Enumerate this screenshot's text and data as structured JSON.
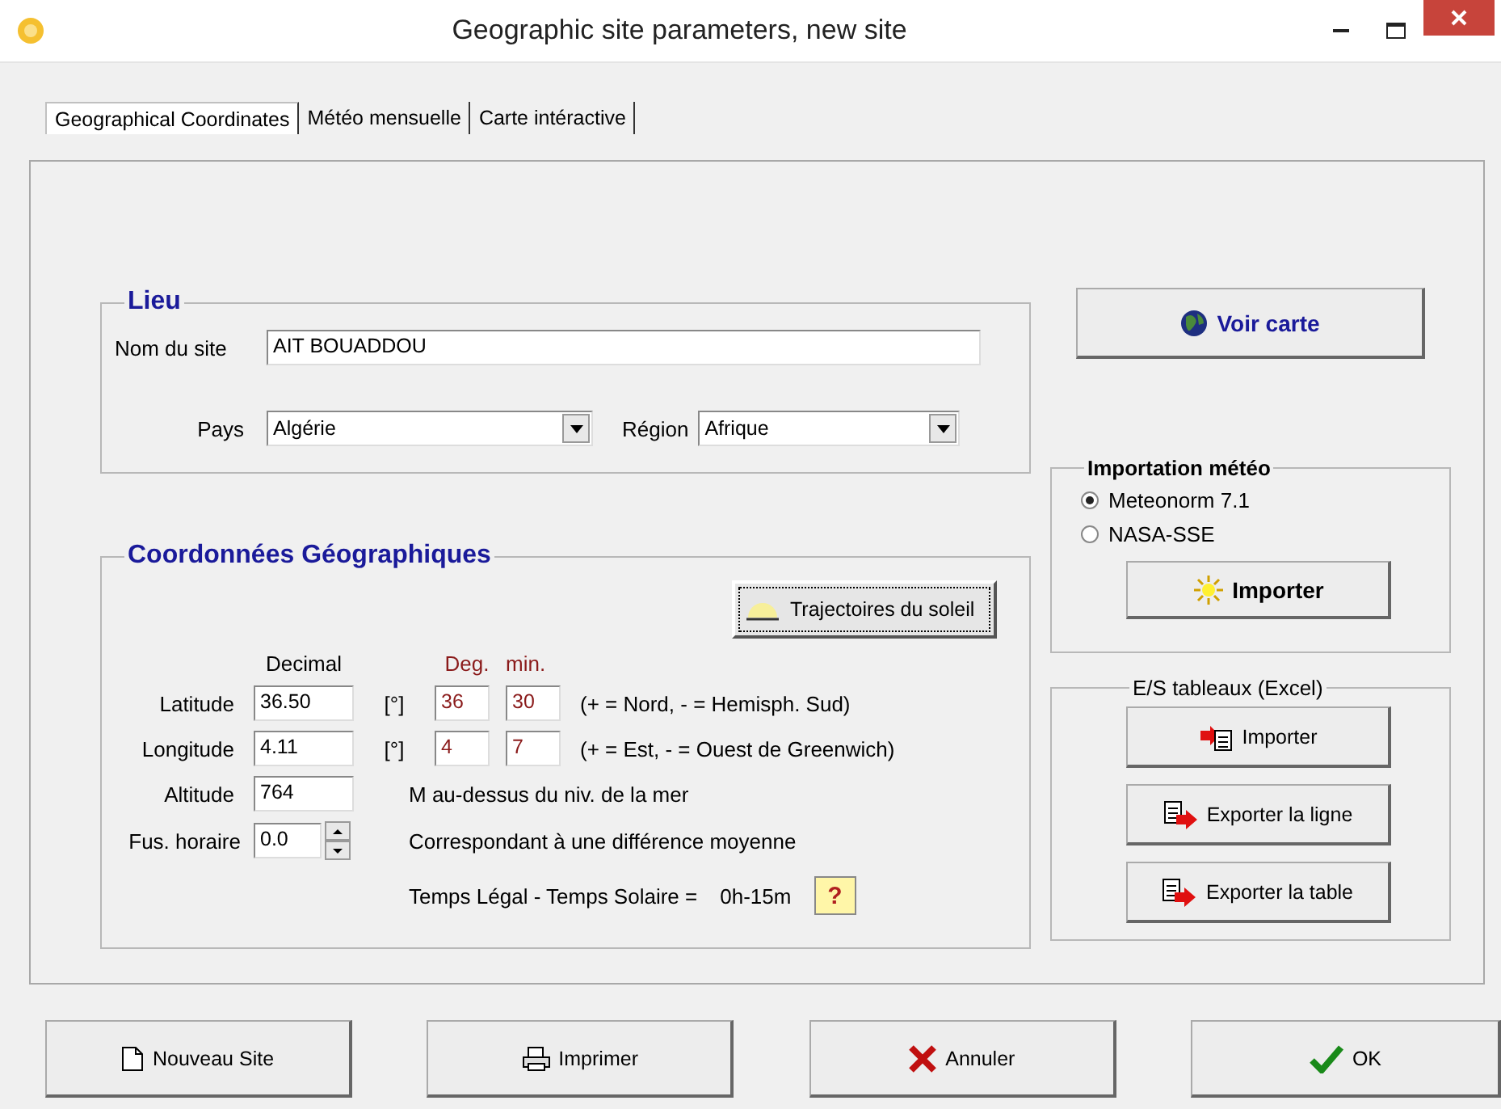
{
  "window": {
    "title": "Geographic site parameters, new site"
  },
  "tabs": [
    {
      "label": "Geographical Coordinates",
      "selected": true
    },
    {
      "label": "Météo mensuelle",
      "selected": false
    },
    {
      "label": "Carte intéractive",
      "selected": false
    }
  ],
  "lieu": {
    "title": "Lieu",
    "site_name": {
      "label": "Nom du site",
      "value": "AIT BOUADDOU"
    },
    "country": {
      "label": "Pays",
      "value": "Algérie"
    },
    "region": {
      "label": "Région",
      "value": "Afrique"
    }
  },
  "coordinates": {
    "title": "Coordonnées Géographiques",
    "sun_paths_button": "Trajectoires du soleil",
    "headers": {
      "decimal": "Decimal",
      "deg": "Deg.",
      "min": "min."
    },
    "rows": [
      {
        "label": "Latitude",
        "decimal": "36.50",
        "unit": "[°]",
        "deg": "36",
        "min": "30",
        "note": "(+ = Nord,  - = Hemisph. Sud)"
      },
      {
        "label": "Longitude",
        "decimal": "4.11",
        "unit": "[°]",
        "deg": "4",
        "min": "7",
        "note": "(+ = Est, - = Ouest de Greenwich)"
      }
    ],
    "altitude": {
      "label": "Altitude",
      "value": "764",
      "note": "M au-dessus du niv. de la mer"
    },
    "time_zone": {
      "label": "Fus. horaire",
      "value": "0.0",
      "note": "Correspondant à une différence moyenne"
    },
    "time_difference": {
      "label": "Temps Légal - Temps Solaire =",
      "value": "0h-15m"
    },
    "help_button": "?"
  },
  "map_button": "Voir carte",
  "weather_import": {
    "title": "Importation météo",
    "sources": [
      {
        "label": "Meteonorm 7.1",
        "selected": true
      },
      {
        "label": "NASA-SSE",
        "selected": false
      }
    ],
    "import_button": "Importer"
  },
  "excel": {
    "title": "E/S tableaux (Excel)",
    "buttons": [
      {
        "label": "Importer",
        "kind": "import"
      },
      {
        "label": "Exporter la ligne",
        "kind": "export"
      },
      {
        "label": "Exporter la table",
        "kind": "export"
      }
    ]
  },
  "footer_buttons": [
    {
      "label": "Nouveau Site",
      "kind": "new"
    },
    {
      "label": "Imprimer",
      "kind": "print"
    },
    {
      "label": "Annuler",
      "kind": "cancel"
    },
    {
      "label": "OK",
      "kind": "ok"
    }
  ]
}
